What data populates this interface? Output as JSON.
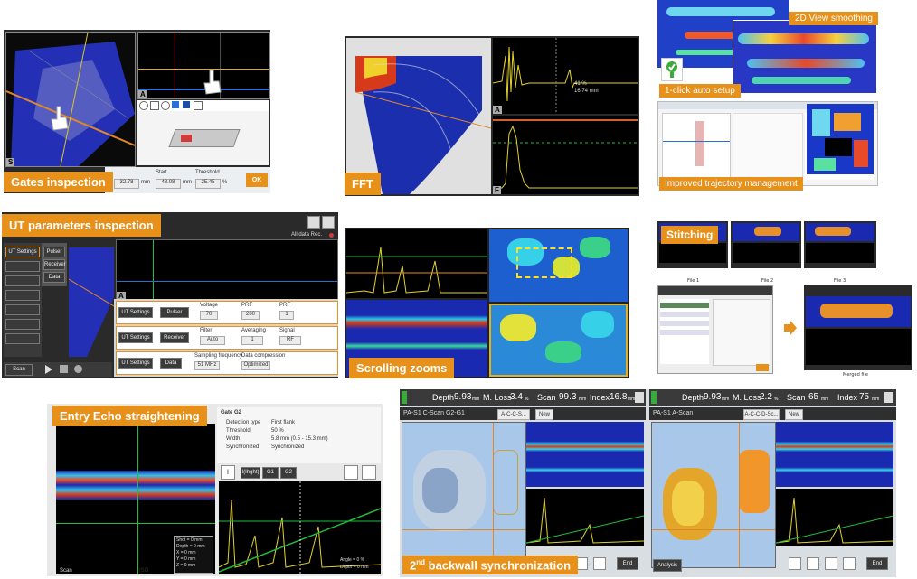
{
  "features": {
    "gates_inspection": "Gates inspection",
    "fft": "FFT",
    "smoothing_2d": "2D View smoothing",
    "auto_setup": "1-click auto setup",
    "trajectory": "Improved trajectory management",
    "ut_params": "UT parameters inspection",
    "scrolling_zooms": "Scrolling zooms",
    "stitching": "Stitching",
    "entry_echo": "Entry Echo straightening",
    "backwall_sync_sup": "nd",
    "backwall_sync_num": "2",
    "backwall_sync_rest": "backwall synchronization"
  },
  "gates_panel": {
    "s_label": "S",
    "a_label": "A",
    "field1": "32.78",
    "unit1": "mm",
    "start_label": "Start",
    "start_value": "48.08",
    "unit2": "mm",
    "threshold_label": "Threshold",
    "threshold_value": "25.45",
    "unit3": "%",
    "ok_label": "OK"
  },
  "fft_panel": {
    "a_label": "A",
    "f_label": "F",
    "readout1": "41 %",
    "readout2": "16.74 mm"
  },
  "ut_panel": {
    "ut_settings_tab": "UT Settings",
    "pulser": "Pulser",
    "receiver": "Receiver",
    "data": "Data",
    "all_data_rec": "All data Rec.",
    "a_label": "A",
    "scan_btn": "Scan",
    "rows": [
      {
        "btn": "UT Settings",
        "sub": "Pulser",
        "f1": "Voltage",
        "v1": "70",
        "f2": "PRF",
        "v2": "200",
        "f3": "PRF",
        "v3": "1"
      },
      {
        "btn": "UT Settings",
        "sub": "Receiver",
        "f1": "Filter",
        "v1": "Auto",
        "f2": "Averaging",
        "v2": "1",
        "f3": "Signal",
        "v3": "RF"
      },
      {
        "btn": "UT Settings",
        "sub": "Data",
        "f1": "Sampling frequency",
        "v1": "51 MHz",
        "f2": "Data compression",
        "v2": "Optimized",
        "f3": "",
        "v3": ""
      }
    ]
  },
  "stitch_panel": {
    "file1": "File 1",
    "file2": "File 2",
    "file3": "File 3",
    "merged": "Merged file"
  },
  "entry_panel": {
    "gate_title": "Gate G2",
    "rows": [
      {
        "k": "Detection type",
        "v": "First flank"
      },
      {
        "k": "Threshold",
        "v": "50 %"
      },
      {
        "k": "Width",
        "v": "5.8 mm (0.5 - 15.3 mm)"
      },
      {
        "k": "Synchronized",
        "v": "Synchronized"
      }
    ],
    "buttons": [
      "I(Ihght)",
      "G1",
      "G2"
    ],
    "readouts": [
      "Shot = 0 mm",
      "Depth = 0 mm",
      "X = 0 mm",
      "Y = 0 mm",
      "Z = 0 mm"
    ],
    "readouts_r": [
      "Angle = 0 %",
      "Depth = 0 mm"
    ],
    "scan_label": "Scan",
    "iso_label": "ISO"
  },
  "backwall_panel": {
    "left": {
      "depth_label": "Depth",
      "depth_value": "9.93",
      "depth_unit": "mm",
      "loss_label": "M. Loss",
      "loss_value": "3.4",
      "loss_unit": "%",
      "scan_label": "Scan",
      "scan_value": "99.3",
      "scan_unit": "mm",
      "index_label": "Index",
      "index_value": "16.8",
      "index_unit": "mm",
      "view_title": "PA-S1 C-Scan G2-G1",
      "layout_btn": "A-C-C-S...",
      "new_btn": "New",
      "end_btn": "End"
    },
    "right": {
      "depth_label": "Depth",
      "depth_value": "9.93",
      "depth_unit": "mm",
      "loss_label": "M. Loss",
      "loss_value": "2.2",
      "loss_unit": "%",
      "scan_label": "Scan",
      "scan_value": "65",
      "scan_unit": "mm",
      "index_label": "Index",
      "index_value": "75",
      "index_unit": "mm",
      "view_title": "PA-S1 A-Scan",
      "layout_btn": "A-C-C-D-Sc...",
      "new_btn": "New",
      "analysis_btn": "Analysis",
      "end_btn": "End"
    }
  },
  "colors": {
    "accent": "#e8911a",
    "scan_blue": "#1f2fa8",
    "signal_yellow": "#e4d22c",
    "gate_green": "#1fbf3a"
  }
}
